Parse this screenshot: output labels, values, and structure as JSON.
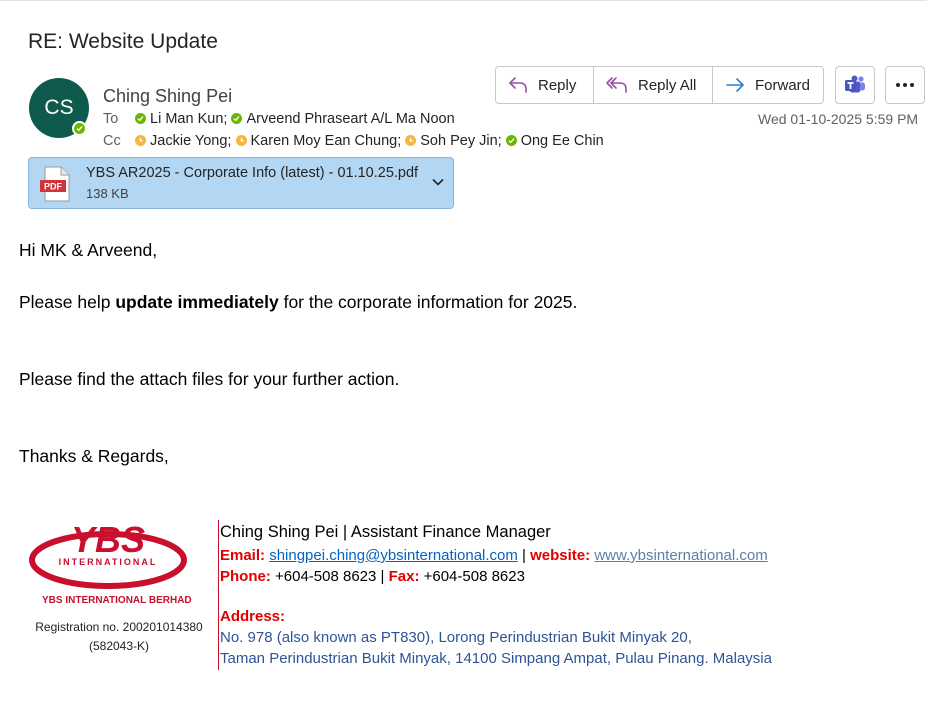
{
  "subject": "RE: Website Update",
  "sender": {
    "initials": "CS",
    "name": "Ching Shing Pei",
    "avatar_color": "#0e5b4d"
  },
  "to": {
    "label": "To",
    "recipients": [
      "Li Man Kun;",
      "Arveend Phraseart A/L Ma Noon"
    ]
  },
  "cc": {
    "label": "Cc",
    "recipients": [
      "Jackie Yong;",
      "Karen Moy Ean Chung;",
      "Soh Pey Jin;",
      "Ong Ee Chin"
    ]
  },
  "actions": {
    "reply": "Reply",
    "reply_all": "Reply All",
    "forward": "Forward"
  },
  "date": "Wed 01-10-2025 5:59 PM",
  "attachment": {
    "type_label": "PDF",
    "filename": "YBS AR2025 - Corporate Info (latest) - 01.10.25.pdf",
    "size": "138 KB"
  },
  "body": {
    "greeting": "Hi MK & Arveend,",
    "line1_pre": "Please help ",
    "line1_bold": "update immediately",
    "line1_post": " for the corporate information for 2025.",
    "line2": "Please find the attach files for your further action.",
    "closing": "Thanks & Regards,"
  },
  "signature": {
    "logo_text": "YBS",
    "logo_sub": "INTERNATIONAL",
    "company": "YBS INTERNATIONAL BERHAD",
    "registration_line1": "Registration no. 200201014380",
    "registration_line2": "(582043-K)",
    "name_title": "Ching Shing Pei | Assistant Finance Manager",
    "email_label": "Email:",
    "email": "shingpei.ching@ybsinternational.com",
    "sep": " | ",
    "website_label": "website:",
    "website": "www.ybsinternational.com",
    "phone_label": "Phone:",
    "phone": " +604-508 8623 | ",
    "fax_label": "Fax:",
    "fax": " +604-508 8623",
    "address_label": "Address:",
    "address_line1": "No. 978 (also known as PT830), Lorong Perindustrian Bukit Minyak 20,",
    "address_line2": "Taman Perindustrian Bukit Minyak, 14100 Simpang Ampat, Pulau Pinang. Malaysia"
  },
  "colors": {
    "accent_red": "#e00000",
    "attachment_bg": "#b3d6f2",
    "presence_available": "#6bb700",
    "presence_away": "#f8b63c"
  },
  "icons": [
    "reply-icon",
    "reply-all-icon",
    "forward-icon",
    "teams-icon",
    "more-icon",
    "pdf-icon",
    "chevron-down-icon"
  ]
}
